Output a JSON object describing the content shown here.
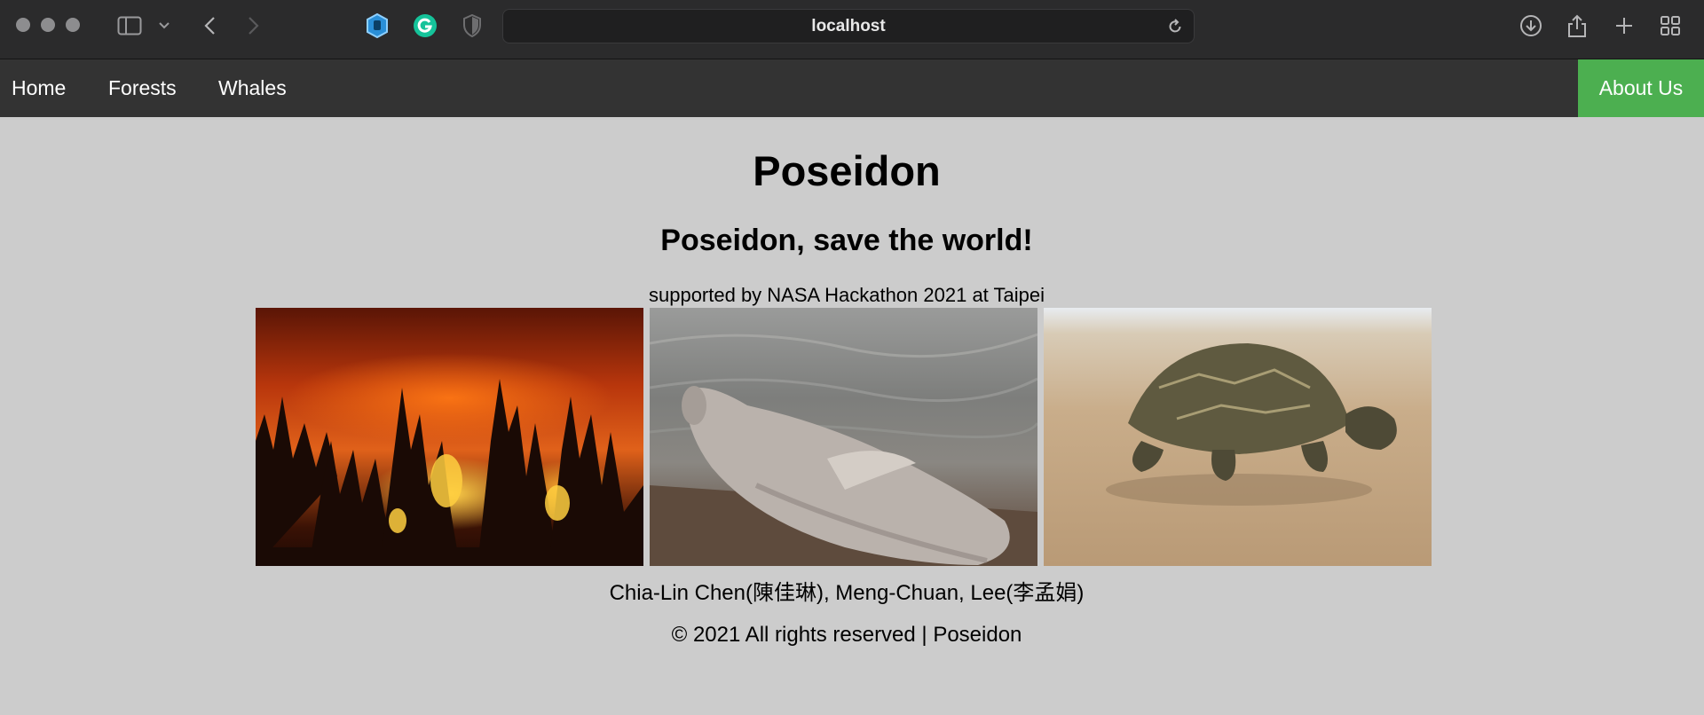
{
  "browser": {
    "url": "localhost"
  },
  "nav": {
    "items": [
      {
        "label": "Home"
      },
      {
        "label": "Forests"
      },
      {
        "label": "Whales"
      }
    ],
    "about_label": "About Us",
    "about_color": "#4caf50"
  },
  "main": {
    "title": "Poseidon",
    "subtitle": "Poseidon, save the world!",
    "supported": "supported by NASA Hackathon 2021 at Taipei",
    "authors": "Chia-Lin Chen(陳佳琳), Meng-Chuan, Lee(李孟娟)",
    "footer": "© 2021 All rights reserved | Poseidon"
  }
}
